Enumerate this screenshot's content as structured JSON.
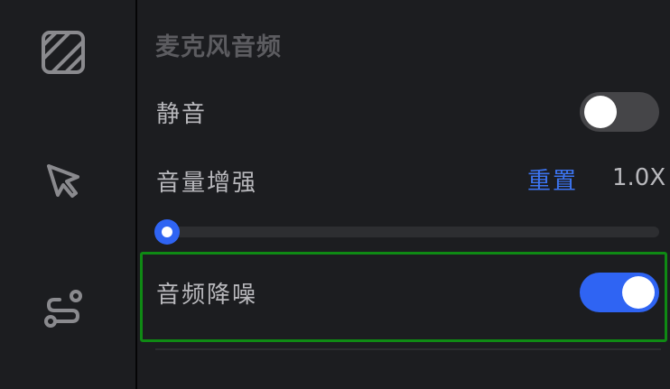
{
  "sidebar": {
    "icons": [
      {
        "name": "hatch-pattern-icon"
      },
      {
        "name": "cursor-arrow-icon"
      },
      {
        "name": "path-curve-icon"
      }
    ]
  },
  "panel": {
    "section_title": "麦克风音频",
    "mute": {
      "label": "静音",
      "enabled": false
    },
    "volume_boost": {
      "label": "音量增强",
      "reset_label": "重置",
      "value": "1.0X",
      "slider_fraction": 0.0
    },
    "noise_reduction": {
      "label": "音频降噪",
      "enabled": true
    }
  },
  "colors": {
    "accent": "#2f64f3",
    "link": "#3c74f0",
    "highlight": "#0f8a14",
    "background": "#1c1d20"
  }
}
